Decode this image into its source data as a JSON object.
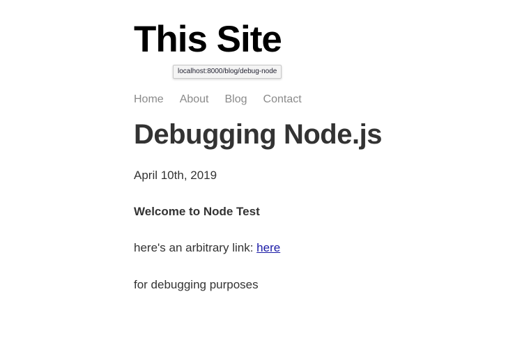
{
  "site": {
    "title": "This Site"
  },
  "tooltip": {
    "url": "localhost:8000/blog/debug-node"
  },
  "nav": {
    "items": [
      {
        "label": "Home"
      },
      {
        "label": "About"
      },
      {
        "label": "Blog"
      },
      {
        "label": "Contact"
      }
    ]
  },
  "post": {
    "title": "Debugging Node.js",
    "date": "April 10th, 2019",
    "heading": "Welcome to Node Test",
    "link_prefix": "here's an arbitrary link: ",
    "link_text": "here",
    "closing": "for debugging purposes"
  },
  "colors": {
    "link": "#1a1aa6",
    "nav": "#8a8a8a",
    "text": "#333333"
  }
}
